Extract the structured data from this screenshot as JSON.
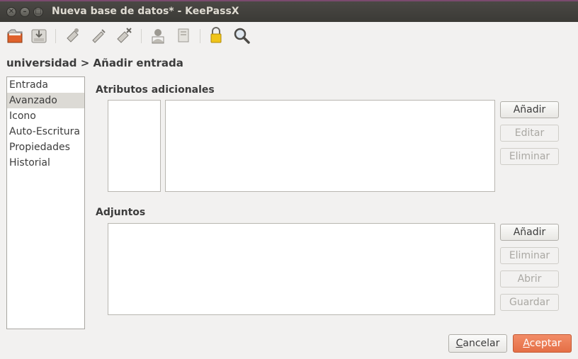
{
  "window": {
    "title": "Nueva base de datos* - KeePassX"
  },
  "toolbar": {
    "icons": [
      "open-database-icon",
      "save-database-icon",
      "add-entry-icon",
      "edit-entry-icon",
      "delete-entry-icon",
      "copy-username-icon",
      "copy-password-icon",
      "lock-icon",
      "search-icon"
    ]
  },
  "heading": "universidad > Añadir entrada",
  "categories": [
    "Entrada",
    "Avanzado",
    "Icono",
    "Auto-Escritura",
    "Propiedades",
    "Historial"
  ],
  "selected_category": "Avanzado",
  "attributes": {
    "title": "Atributos adicionales",
    "add_label": "Añadir",
    "edit_label": "Editar",
    "remove_label": "Eliminar"
  },
  "attachments": {
    "title": "Adjuntos",
    "add_label": "Añadir",
    "remove_label": "Eliminar",
    "open_label": "Abrir",
    "save_label": "Guardar"
  },
  "footer": {
    "cancel_first": "C",
    "cancel_rest": "ancelar",
    "accept_first": "A",
    "accept_rest": "ceptar"
  },
  "colors": {
    "accent": "#e56f46",
    "title_bar": "#3b3a36"
  }
}
